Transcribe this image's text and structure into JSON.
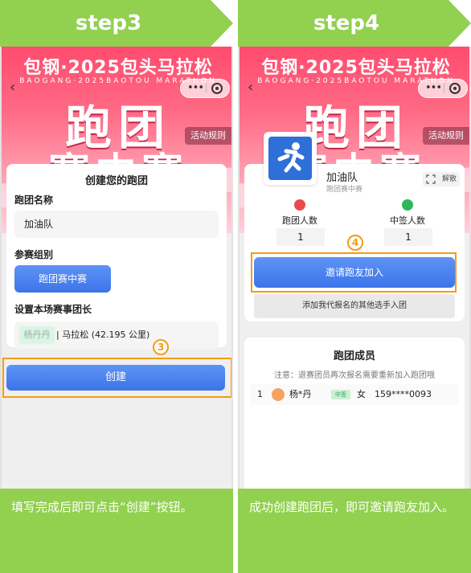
{
  "left": {
    "step_title": "step3",
    "banner": {
      "title": "包钢·2025包头马拉松",
      "subtitle": "BAOGANG·2025BAOTOU MARATHON",
      "big1": "跑团",
      "big2": "赛中赛"
    },
    "rules_label": "活动规则",
    "form": {
      "title": "创建您的跑团",
      "team_name_label": "跑团名称",
      "team_name_value": "加油队",
      "group_label": "参赛组别",
      "group_option": "跑团赛中赛",
      "captain_label": "设置本场赛事团长",
      "captain_name": "杨丹丹",
      "captain_race": "| 马拉松 (42.195 公里)"
    },
    "step_badge": "3",
    "create_button": "创建",
    "caption": "填写完成后即可点击“创建”按钮。"
  },
  "right": {
    "step_title": "step4",
    "banner": {
      "title": "包钢·2025包头马拉松",
      "subtitle": "BAOGANG·2025BAOTOU MARATHON",
      "big1": "跑团",
      "big2": "赛中赛"
    },
    "rules_label": "活动规则",
    "team": {
      "name": "加油队",
      "type": "跑团赛中赛",
      "unlink_label": "解散",
      "members_label": "跑团人数",
      "members_value": "1",
      "signed_label": "中签人数",
      "signed_value": "1"
    },
    "step_badge": "4",
    "invite_button": "邀请跑友加入",
    "add_button": "添加我代报名的其他选手入团",
    "members": {
      "title": "跑团成员",
      "note": "注意：退赛团员再次报名需要重新加入跑团哦",
      "rows": [
        {
          "index": "1",
          "name": "杨*丹",
          "tag": "中签",
          "gender": "女",
          "phone": "159****0093"
        }
      ]
    },
    "caption": "成功创建跑团后，即可邀请跑友加入。"
  },
  "colors": {
    "header_green": "#92d050",
    "highlight_orange": "#f39c12",
    "button_blue": "#3c74ea",
    "banner_pink": "#ff4b6e"
  }
}
